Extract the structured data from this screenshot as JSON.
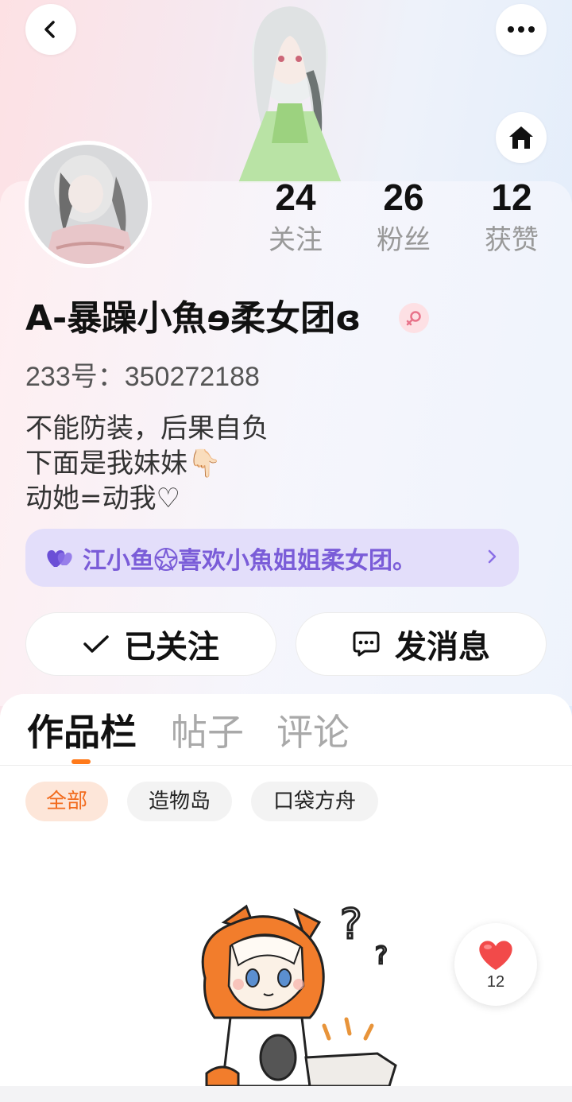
{
  "header": {
    "back_icon": "chevron-left-icon",
    "more_icon": "more-horizontal-icon",
    "home_icon": "home-icon"
  },
  "profile": {
    "stats": [
      {
        "value": "24",
        "label": "关注"
      },
      {
        "value": "26",
        "label": "粉丝"
      },
      {
        "value": "12",
        "label": "获赞"
      }
    ],
    "nickname": "A-暴躁小魚ɘ柔女团ɞ",
    "gender": "female",
    "user_id": "233号：350272188",
    "bio": [
      "不能防装，后果自负",
      "下面是我妹妹👇🏻",
      "动她=动我♡"
    ],
    "group_banner": "江小鱼☆⃝喜欢小魚姐姐柔女团。",
    "follow_label": "已关注",
    "message_label": "发消息"
  },
  "tabs": [
    {
      "label": "作品栏",
      "active": true
    },
    {
      "label": "帖子",
      "active": false
    },
    {
      "label": "评论",
      "active": false
    }
  ],
  "filters": [
    {
      "label": "全部",
      "active": true
    },
    {
      "label": "造物岛",
      "active": false
    },
    {
      "label": "口袋方舟",
      "active": false
    }
  ],
  "like_fab": {
    "count": "12"
  },
  "colors": {
    "accent": "#ff7a1a",
    "group_purple": "#7a5cd8",
    "gender_pink": "#e8738a"
  }
}
